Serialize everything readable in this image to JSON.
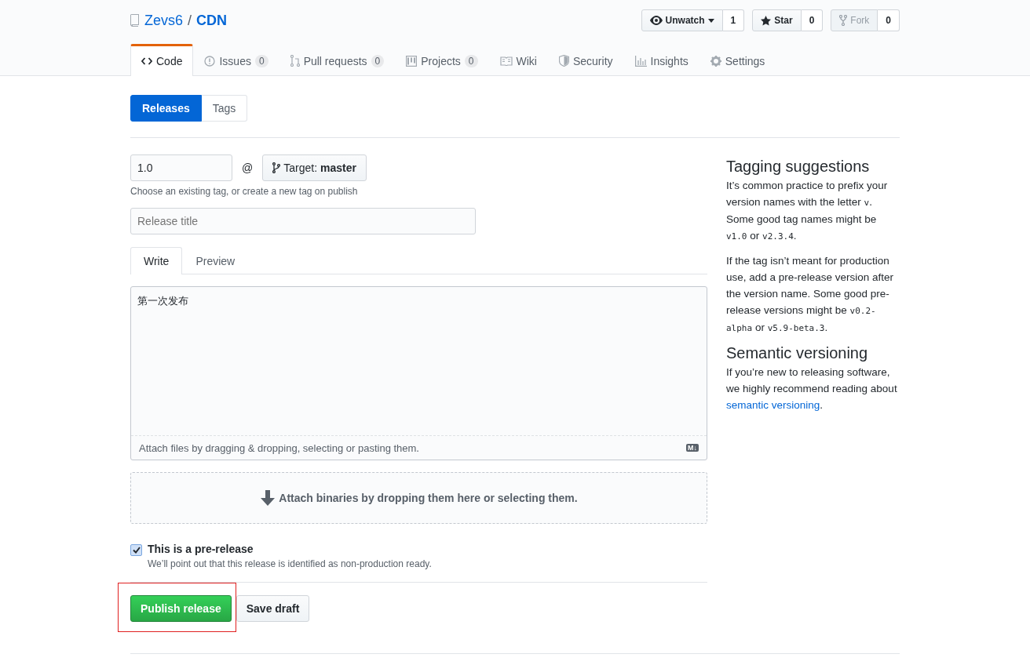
{
  "repo": {
    "owner": "Zevs6",
    "separator": "/",
    "name": "CDN"
  },
  "repo_actions": [
    {
      "kind": "watch",
      "label": "Unwatch",
      "count": "1",
      "disabled": false
    },
    {
      "kind": "star",
      "label": "Star",
      "count": "0",
      "disabled": false
    },
    {
      "kind": "fork",
      "label": "Fork",
      "count": "0",
      "disabled": true
    }
  ],
  "nav_tabs": [
    {
      "kind": "code",
      "label": "Code",
      "selected": true
    },
    {
      "kind": "issues",
      "label": "Issues",
      "count": "0",
      "selected": false
    },
    {
      "kind": "pulls",
      "label": "Pull requests",
      "count": "0",
      "selected": false
    },
    {
      "kind": "projects",
      "label": "Projects",
      "count": "0",
      "selected": false
    },
    {
      "kind": "wiki",
      "label": "Wiki",
      "selected": false
    },
    {
      "kind": "security",
      "label": "Security",
      "selected": false
    },
    {
      "kind": "insights",
      "label": "Insights",
      "selected": false
    },
    {
      "kind": "settings",
      "label": "Settings",
      "selected": false
    }
  ],
  "subnav": [
    {
      "label": "Releases",
      "selected": true
    },
    {
      "label": "Tags",
      "selected": false
    }
  ],
  "form": {
    "tag_value": "1.0",
    "at": "@",
    "target_prefix": "Target:",
    "target_branch": "master",
    "tag_hint": "Choose an existing tag, or create a new tag on publish",
    "title_placeholder": "Release title",
    "editor_tabs": [
      {
        "label": "Write",
        "selected": true
      },
      {
        "label": "Preview",
        "selected": false
      }
    ],
    "body": "第一次发布",
    "attach_files": "Attach files by dragging & dropping, selecting or pasting them.",
    "markdown_badge": "M↓",
    "attach_binaries": "Attach binaries by dropping them here or selecting them.",
    "prerelease": {
      "label": "This is a pre-release",
      "checked": true,
      "note": "We’ll point out that this release is identified as non-production ready."
    },
    "publish_button": {
      "label": "Publish release",
      "highlighted": true
    },
    "draft_button": "Save draft"
  },
  "sidebar": [
    {
      "heading": "Tagging suggestions",
      "paragraphs": [
        [
          {
            "text": "It’s common practice to prefix your version names with the letter "
          },
          {
            "text": "v",
            "code": true
          },
          {
            "text": ". Some good tag names might be "
          },
          {
            "text": "v1.0",
            "code": true
          },
          {
            "text": " or "
          },
          {
            "text": "v2.3.4",
            "code": true
          },
          {
            "text": "."
          }
        ],
        [
          {
            "text": "If the tag isn’t meant for production use, add a pre-release version after the version name. Some good pre-release versions might be "
          },
          {
            "text": "v0.2-alpha",
            "code": true
          },
          {
            "text": " or "
          },
          {
            "text": "v5.9-beta.3",
            "code": true
          },
          {
            "text": "."
          }
        ]
      ]
    },
    {
      "heading": "Semantic versioning",
      "paragraphs": [
        [
          {
            "text": "If you’re new to releasing software, we highly recommend reading about "
          },
          {
            "text": "semantic versioning",
            "link": true
          },
          {
            "text": "."
          }
        ]
      ]
    }
  ]
}
